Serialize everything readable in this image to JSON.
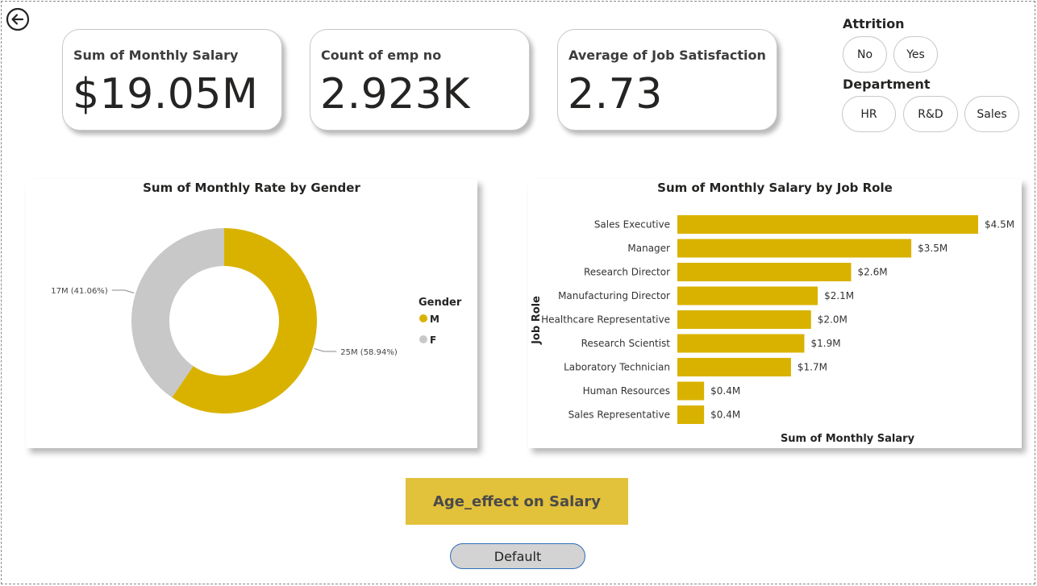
{
  "cards": [
    {
      "title": "Sum of Monthly Salary",
      "value": "$19.05M"
    },
    {
      "title": "Count of emp no",
      "value": "2.923K"
    },
    {
      "title": "Average of Job Satisfaction",
      "value": "2.73"
    }
  ],
  "slicers": {
    "attrition": {
      "title": "Attrition",
      "options": [
        "No",
        "Yes"
      ]
    },
    "department": {
      "title": "Department",
      "options": [
        "HR",
        "R&D",
        "Sales"
      ]
    }
  },
  "buttons": {
    "action": "Age_effect on Salary",
    "default": "Default"
  },
  "icons": {
    "back": "back-arrow-icon"
  },
  "colors": {
    "accent": "#d9b200",
    "secondary": "#c8c8c8",
    "button": "#e2c13b"
  },
  "chart_data": [
    {
      "type": "pie",
      "variant": "donut",
      "title": "Sum of Monthly Rate by Gender",
      "legend_title": "Gender",
      "legend_position": "right",
      "labels": [
        "M",
        "F"
      ],
      "values": [
        25,
        17
      ],
      "percents": [
        58.94,
        41.06
      ],
      "data_labels": [
        "25M (58.94%)",
        "17M (41.06%)"
      ],
      "colors": [
        "#d9b200",
        "#c8c8c8"
      ]
    },
    {
      "type": "bar",
      "orientation": "horizontal",
      "title": "Sum of Monthly Salary by Job Role",
      "xlabel": "Sum of Monthly Salary",
      "ylabel": "Job Role",
      "categories": [
        "Sales Executive",
        "Manager",
        "Research Director",
        "Manufacturing Director",
        "Healthcare Representative",
        "Research Scientist",
        "Laboratory Technician",
        "Human Resources",
        "Sales Representative"
      ],
      "values": [
        4.5,
        3.5,
        2.6,
        2.1,
        2.0,
        1.9,
        1.7,
        0.4,
        0.4
      ],
      "data_labels": [
        "$4.5M",
        "$3.5M",
        "$2.6M",
        "$2.1M",
        "$2.0M",
        "$1.9M",
        "$1.7M",
        "$0.4M",
        "$0.4M"
      ],
      "xlim": [
        0,
        4.5
      ],
      "grid": false,
      "color": "#d9b200"
    }
  ]
}
